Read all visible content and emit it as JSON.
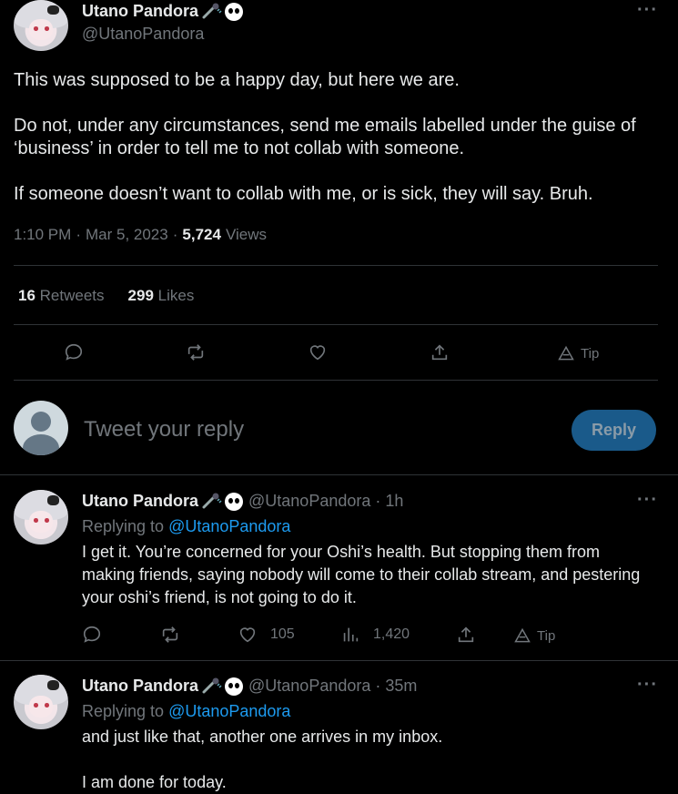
{
  "main_tweet": {
    "author_name": "Utano Pandora",
    "handle": "@UtanoPandora",
    "paragraphs": [
      "This was supposed to be a happy day, but here we are.",
      "Do not, under any circumstances, send me emails labelled under the guise of ‘business’ in order to tell me to not collab with someone.",
      "If someone doesn’t want to collab with me, or is sick, they will say. Bruh."
    ],
    "time": "1:10 PM",
    "date": "Mar 5, 2023",
    "views_count": "5,724",
    "views_label": "Views",
    "retweets_count": "16",
    "retweets_label": "Retweets",
    "likes_count": "299",
    "likes_label": "Likes",
    "more": "···"
  },
  "actions": {
    "tip_label": "Tip"
  },
  "reply_box": {
    "placeholder": "Tweet your reply",
    "button_label": "Reply"
  },
  "replies": [
    {
      "author_name": "Utano Pandora",
      "handle": "@UtanoPandora",
      "age": "1h",
      "replying_to_label": "Replying to",
      "replying_to": "@UtanoPandora",
      "text": "I get it. You’re concerned for your Oshi’s health. But stopping them from making friends, saying nobody will come to their collab stream, and pestering your oshi’s friend, is not going to do it.",
      "likes": "105",
      "views": "1,420",
      "tip_label": "Tip",
      "more": "···"
    },
    {
      "author_name": "Utano Pandora",
      "handle": "@UtanoPandora",
      "age": "35m",
      "replying_to_label": "Replying to",
      "replying_to": "@UtanoPandora",
      "text_line1": "and just like that, another one arrives in my inbox.",
      "text_line2": "I am done for today.",
      "more": "···"
    }
  ],
  "colors": {
    "accent": "#1d9bf0",
    "reply_button": "#1a5a8a",
    "muted": "#71767b",
    "divider": "#2f3336"
  },
  "separator": "·"
}
